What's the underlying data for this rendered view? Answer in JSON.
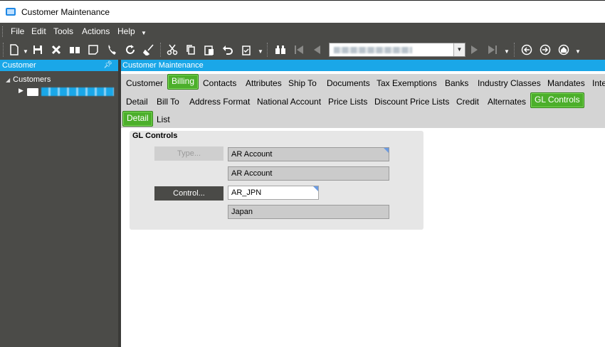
{
  "window": {
    "title": "Customer Maintenance"
  },
  "menubar": {
    "items": [
      "File",
      "Edit",
      "Tools",
      "Actions",
      "Help"
    ]
  },
  "toolbar": {
    "icons": [
      "new-icon",
      "save-icon",
      "delete-icon",
      "book-icon",
      "note-icon",
      "phone-icon",
      "refresh-icon",
      "clear-icon",
      "cut-icon",
      "copy-icon",
      "paste-icon",
      "undo-icon",
      "clipboard-icon",
      "binoculars-icon",
      "first-icon",
      "prev-icon",
      "next-icon",
      "last-icon",
      "back-icon",
      "forward-icon",
      "home-icon"
    ]
  },
  "left_panel": {
    "header": "Customer",
    "tree": {
      "root_label": "Customers"
    }
  },
  "main": {
    "header": "Customer Maintenance",
    "primary_tabs": [
      "Customer",
      "Billing",
      "Contacts",
      "Attributes",
      "Ship To",
      "Documents",
      "Tax Exemptions",
      "Banks",
      "Industry Classes",
      "Mandates",
      "Inte"
    ],
    "primary_active": "Billing",
    "secondary_tabs": [
      "Detail",
      "Bill To",
      "Address Format",
      "National Account",
      "Price Lists",
      "Discount Price Lists",
      "Credit",
      "Alternates",
      "GL Controls"
    ],
    "secondary_active": "GL Controls",
    "tertiary_tabs": [
      "Detail",
      "List"
    ],
    "tertiary_active": "Detail"
  },
  "gl_controls": {
    "title": "GL Controls",
    "type_button": "Type...",
    "type_value": "AR Account",
    "type_description": "AR Account",
    "control_button": "Control...",
    "control_value": "AR_JPN",
    "control_description": "Japan"
  },
  "colors": {
    "accent": "#1aa7e8",
    "active_tab": "#4caf2b",
    "chrome": "#4a4a47"
  }
}
